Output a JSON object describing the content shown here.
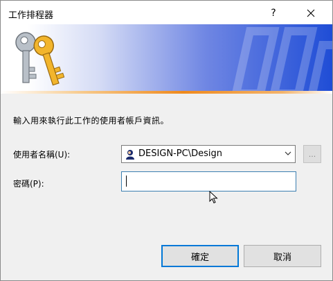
{
  "window": {
    "title": "工作排程器",
    "help_glyph": "?"
  },
  "prompt": "輸入用來執行此工作的使用者帳戶資訊。",
  "form": {
    "username_label": "使用者名稱(U):",
    "username_value": "DESIGN-PC\\Design",
    "browse_label": "...",
    "password_label": "密碼(P):",
    "password_value": ""
  },
  "buttons": {
    "ok": "確定",
    "cancel": "取消"
  },
  "icons": {
    "banner": "keys-icon",
    "user": "user-icon",
    "dropdown": "chevron-down-icon",
    "close": "close-icon"
  },
  "colors": {
    "banner_blue": "#1f4dd6",
    "banner_orange_line": "#ef8a1d",
    "focus_border": "#0078d7"
  }
}
